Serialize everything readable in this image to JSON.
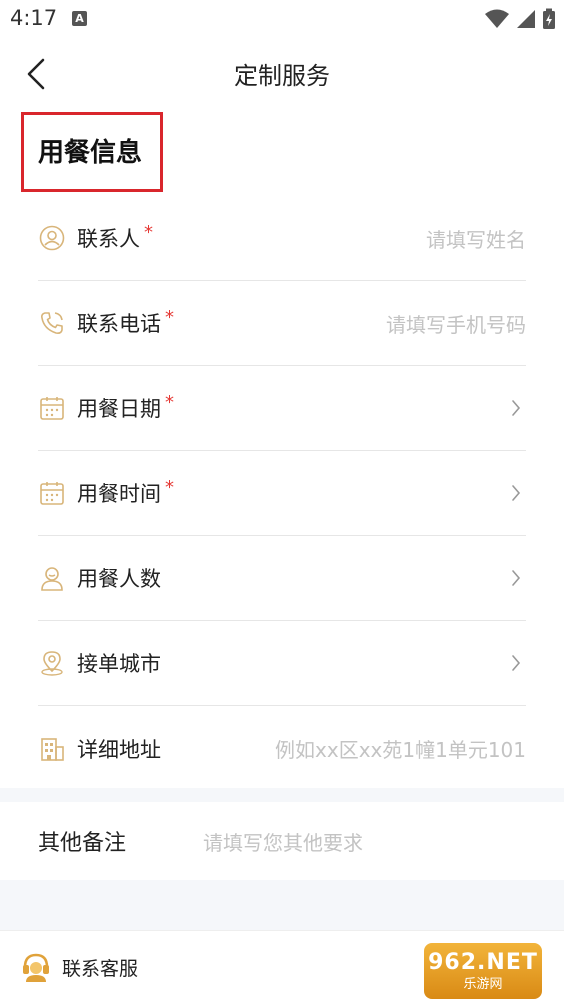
{
  "status_bar": {
    "time": "4:17",
    "notif_letter": "A"
  },
  "nav": {
    "title": "定制服务"
  },
  "section": {
    "title": "用餐信息"
  },
  "rows": [
    {
      "label": "联系人",
      "required": "*",
      "placeholder": "请填写姓名",
      "icon": "contact-person-icon"
    },
    {
      "label": "联系电话",
      "required": "*",
      "placeholder": "请填写手机号码",
      "icon": "phone-icon"
    },
    {
      "label": "用餐日期",
      "required": "*",
      "placeholder": "",
      "icon": "calendar-icon"
    },
    {
      "label": "用餐时间",
      "required": "*",
      "placeholder": "",
      "icon": "calendar-icon"
    },
    {
      "label": "用餐人数",
      "required": "",
      "placeholder": "",
      "icon": "person-icon"
    },
    {
      "label": "接单城市",
      "required": "",
      "placeholder": "",
      "icon": "location-icon"
    },
    {
      "label": "详细地址",
      "required": "",
      "placeholder": "例如xx区xx苑1幢1单元101",
      "icon": "building-icon"
    }
  ],
  "remark": {
    "label": "其他备注",
    "placeholder": "请填写您其他要求"
  },
  "footer": {
    "support_label": "联系客服"
  },
  "watermark": {
    "top": "962.NET",
    "bottom": "乐游网"
  },
  "colors": {
    "accent_gold": "#d8b57a",
    "required_red": "#e53935",
    "highlight_box": "#d9262c"
  }
}
